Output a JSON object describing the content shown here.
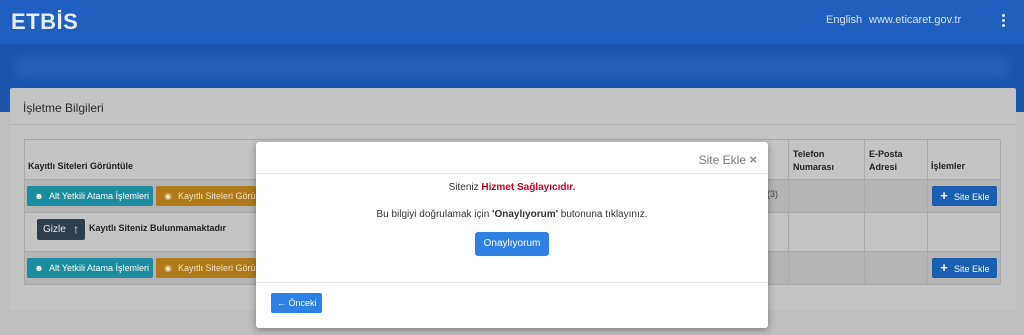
{
  "header": {
    "logo": "ETBİS",
    "language": "English",
    "site": "www.eticaret.gov.tr",
    "menu_icon": "kebab-menu-icon"
  },
  "card": {
    "title": "İşletme Bilgileri"
  },
  "table": {
    "col_view": "Kayıtlı Siteleri Görüntüle",
    "col_phone": "Telefon Numarası",
    "col_email": "E-Posta Adresi",
    "col_actions": "İşlemler",
    "btn_assign": "Alt Yetkili Atama İşlemleri",
    "btn_view": "Kayıtlı Siteleri Görü",
    "btn_add": "Site Ekle",
    "count_text": "(3)",
    "hide_label": "Gizle",
    "no_site": "Kayıtlı Siteniz Bulunmamaktadır"
  },
  "modal": {
    "title": "Site Ekle",
    "close": "×",
    "line1_prefix": "Siteniz",
    "line1_highlight": "Hizmet Sağlayıcıdır.",
    "line2_prefix": "Bu bilgiyi doğrulamak için",
    "line2_highlight": "'Onaylıyorum'",
    "line2_suffix": "butonuna tıklayınız.",
    "confirm_button": "Onaylıyorum",
    "previous_button": "Önceki"
  },
  "colors": {
    "header": "#1f5fbf",
    "primary": "#2f80e4",
    "danger": "#d0011b"
  }
}
